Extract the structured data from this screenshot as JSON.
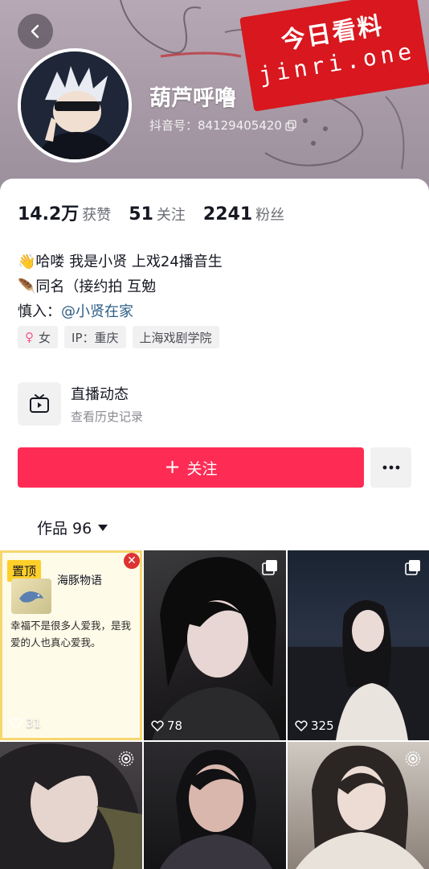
{
  "header": {
    "nickname": "葫芦呼噜",
    "douyin_id": "抖音号：84129405420",
    "back_icon": "chevron-left-icon",
    "copy_icon": "copy-icon"
  },
  "watermark": {
    "line1": "今日看料",
    "line2": "jinri.one"
  },
  "stats": [
    {
      "value": "14.2万",
      "label": "获赞"
    },
    {
      "value": "51",
      "label": "关注"
    },
    {
      "value": "2241",
      "label": "粉丝"
    }
  ],
  "bio": {
    "line1": "👋哈喽 我是小贤 上戏24播音生",
    "line2": "🪶同名（接约拍 互勉",
    "line3_prefix": "慎入：",
    "line3_mention": "@小贤在家"
  },
  "tags": {
    "gender": "女",
    "ip": "IP：重庆",
    "school": "上海戏剧学院"
  },
  "live": {
    "title": "直播动态",
    "subtitle": "查看历史记录"
  },
  "follow": {
    "label": "关注"
  },
  "works_tab": {
    "label": "作品 96"
  },
  "grid": {
    "pinned": {
      "badge": "置顶",
      "name": "海豚物语",
      "quote": "幸福不是很多人爱我，是我爱的人也真心爱我。",
      "likes": "31"
    },
    "items": [
      {
        "likes": "78",
        "icon": "gallery-icon"
      },
      {
        "likes": "325",
        "icon": "gallery-icon"
      },
      {
        "likes": "",
        "icon": "live-photo-icon"
      },
      {
        "likes": "",
        "icon": ""
      },
      {
        "likes": "",
        "icon": "live-photo-icon"
      }
    ]
  },
  "colors": {
    "accent": "#fe2c55",
    "mention": "#2c5d86",
    "watermark_red": "#d8171e"
  }
}
